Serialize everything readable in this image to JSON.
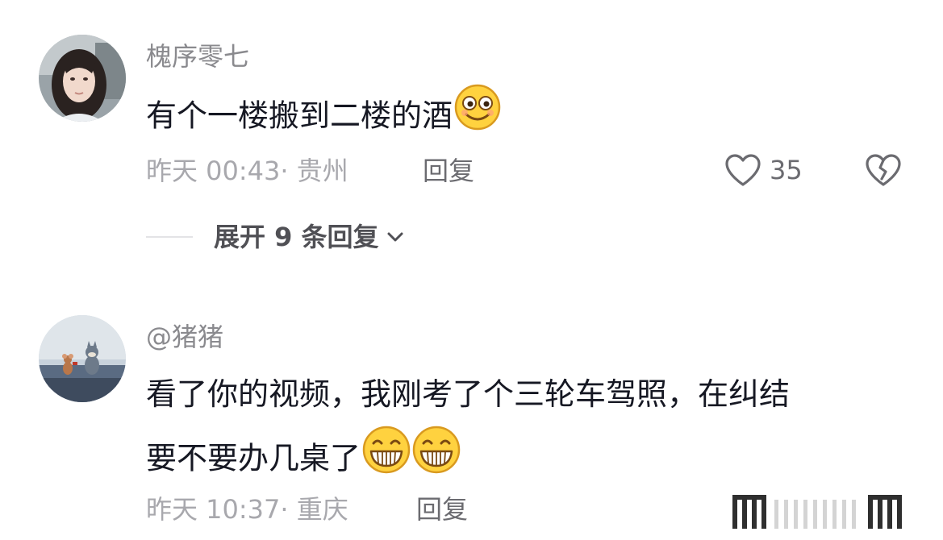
{
  "comments": [
    {
      "username": "槐序零七",
      "text": "有个一楼搬到二楼的酒",
      "emoji": "smile-emoji",
      "timestamp": "昨天 00:43· 贵州",
      "reply_label": "回复",
      "likes": "35",
      "expand_label": "展开 9 条回复"
    },
    {
      "username": "@猪猪",
      "text_line1": "看了你的视频，我刚考了个三轮车驾照，在纠结",
      "text_line2": "要不要办几桌了",
      "emojis": [
        "grin-emoji",
        "grin-emoji"
      ],
      "timestamp": "昨天 10:37· 重庆",
      "reply_label": "回复"
    }
  ],
  "colors": {
    "text_primary": "#161823",
    "text_secondary": "#8a8a8e",
    "text_meta": "#a8a8ad",
    "emoji_yellow": "#ffd23f"
  }
}
